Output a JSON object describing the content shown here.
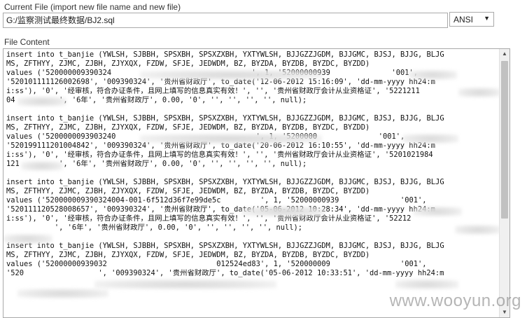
{
  "current_file_label": "Current File (import new file name and new file)",
  "file_path": "G:/监察测试最终数据/BJ2.sql",
  "encoding": {
    "selected": "ANSI",
    "arrow_glyph": "▼"
  },
  "file_content_label": "File Content",
  "content_blocks": [
    {
      "lines": [
        "insert into t_banjie (YWLSH, SJBBH, SPSXBH, SPSXZXBH, YXTYWLSH, BJJGZZJGDM, BJJGMC, BJSJ, BJJG, BLJG",
        "MS, ZFTHYY, ZJMC, ZJBH, ZJYXQX, FZDW, SFJE, JEDWDM, BZ, BYZDA, BYZDB, BYZDC, BYZDD)",
        "values ('520000009390324                                ', 1, '52000000939              '001',",
        "'520101111126002698', '009390324', '贵州省财政厅', to_date('12-06-2012 15:16:09', 'dd-mm-yyyy hh24:m",
        "i:ss'), '0', '经审核，符合办证条件，且网上填写的信息真实有效！', '', '贵州省财政厅会计从业资格证', '5221211",
        "04          ', '6年', '贵州省财政厅', 0.00, '0', '', '', '', '', null);"
      ]
    },
    {
      "lines": [
        "insert into t_banjie (YWLSH, SJBBH, SPSXBH, SPSXZXBH, YXTYWLSH, BJJGZZJGDM, BJJGMC, BJSJ, BJJG, BLJG",
        "MS, ZFTHYY, ZJMC, ZJBH, ZJYXQX, FZDW, SFJE, JEDWDM, BZ, BYZDA, BYZDB, BYZDC, BYZDD)",
        "values ('5200000093903240                                ', 1, '5200000              '001',",
        "'520199111201004842', '009390324', '贵州省财政厅', to_date('20-06-2012 16:10:55', 'dd-mm-yyyy hh24:m",
        "i:ss'), '0', '经审核，符合办证条件，且网上填写的信息真实有效！', '', '贵州省财政厅会计从业资格证', '5201021984",
        "121         ', '6年', '贵州省财政厅', 0.00, '0', '', '', '', '', null);"
      ]
    },
    {
      "lines": [
        "insert into t_banjie (YWLSH, SJBBH, SPSXBH, SPSXZXBH, YXTYWLSH, BJJGZZJGDM, BJJGMC, BJSJ, BJJG, BLJG",
        "MS, ZFTHYY, ZJMC, ZJBH, ZJYXQX, FZDW, SFJE, JEDWDM, BZ, BYZDA, BYZDB, BYZDC, BYZDD)",
        "values ('520000009390324004-001-6f512d36f7e99de5c         ', 1, '52000000939              '001',",
        "'520111120528008657', '009390324', '贵州省财政厅', to_date('05-06-2012 10:28:34', 'dd-mm-yyyy hh24:m",
        "i:ss'), '0', '经审核，符合办证条件，且网上填写的信息真实有效！', '', '贵州省财政厅会计从业资格证', '52212",
        "           ', '6年', '贵州省财政厅', 0.00, '0', '', '', '', '', null);"
      ]
    },
    {
      "lines": [
        "insert into t_banjie (YWLSH, SJBBH, SPSXBH, SPSXZXBH, YXTYWLSH, BJJGZZJGDM, BJJGMC, BJSJ, BJJG, BLJG",
        "MS, ZFTHYY, ZJMC, ZJBH, ZJYXQX, FZDW, SFJE, JEDWDM, BZ, BYZDA, BYZDB, BYZDC, BYZDD)",
        "values ('52000000939032                         012524ed83', 1, '520000009                '001',",
        "'520                 ', '009390324', '贵州省财政厅', to_date('05-06-2012 10:33:51', 'dd-mm-yyyy hh24:m"
      ]
    }
  ],
  "scrollbar": {
    "up_glyph": "▲",
    "down_glyph": "▼"
  },
  "watermark": "www.wooyun.org"
}
